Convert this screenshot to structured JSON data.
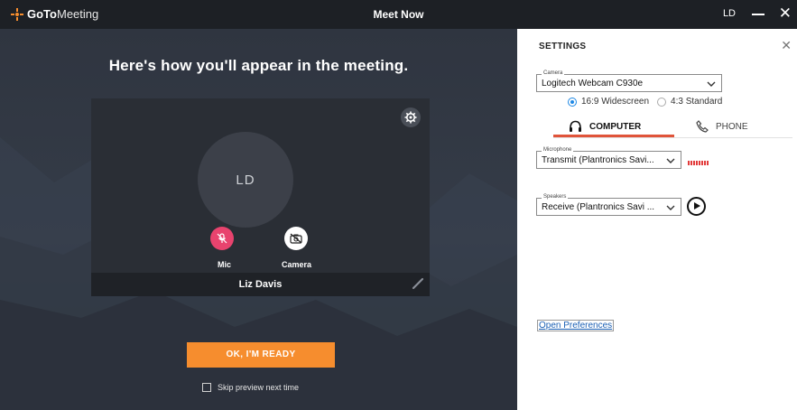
{
  "titlebar": {
    "brand_bold": "GoTo",
    "brand_light": "Meeting",
    "title": "Meet Now",
    "user_initials": "LD",
    "close_glyph": "✕"
  },
  "preview": {
    "heading": "Here's how you'll appear in the meeting.",
    "avatar_initials": "LD",
    "mic_label": "Mic",
    "camera_label": "Camera",
    "user_name": "Liz Davis",
    "ready_button": "OK, I'M READY",
    "skip_label": "Skip preview next time"
  },
  "settings": {
    "title": "SETTINGS",
    "close_glyph": "✕",
    "camera": {
      "legend": "Camera",
      "value": "Logitech Webcam C930e"
    },
    "aspect_options": [
      {
        "label": "16:9 Widescreen",
        "selected": true
      },
      {
        "label": "4:3 Standard",
        "selected": false
      }
    ],
    "tabs": [
      {
        "label": "COMPUTER",
        "active": true
      },
      {
        "label": "PHONE",
        "active": false
      }
    ],
    "microphone": {
      "legend": "Microphone",
      "value": "Transmit (Plantronics Savi..."
    },
    "speakers": {
      "legend": "Speakers",
      "value": "Receive (Plantronics Savi ..."
    },
    "open_preferences": "Open Preferences"
  },
  "colors": {
    "accent_orange": "#f68d2e",
    "mic_muted_pink": "#e8436e",
    "tab_underline": "#e0543a",
    "radio_blue": "#1e88e5"
  },
  "icons": {
    "logo": "gotomeeting-logo-icon",
    "gear": "gear-icon",
    "mic": "mic-muted-icon",
    "camera": "camera-off-icon",
    "pencil": "pencil-icon",
    "headset": "headset-icon",
    "phone": "phone-icon",
    "chevron": "chevron-down-icon",
    "play": "play-icon"
  }
}
